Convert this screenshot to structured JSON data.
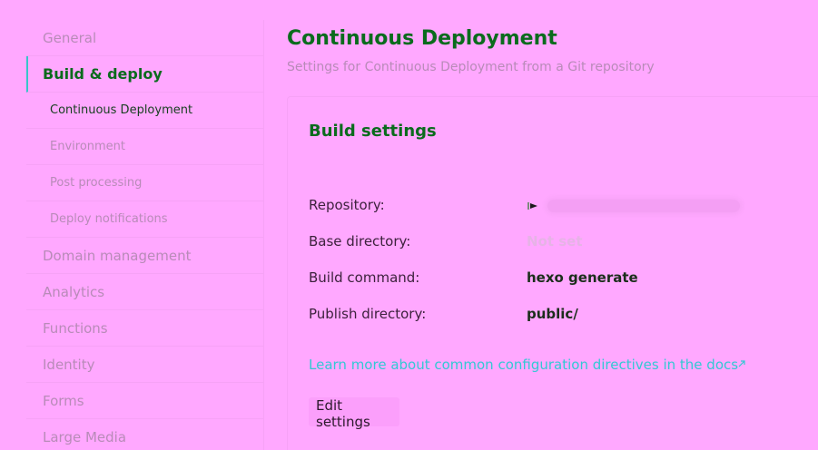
{
  "sidebar": {
    "items": [
      {
        "label": "General"
      },
      {
        "label": "Build & deploy"
      },
      {
        "label": "Continuous Deployment"
      },
      {
        "label": "Environment"
      },
      {
        "label": "Post processing"
      },
      {
        "label": "Deploy notifications"
      },
      {
        "label": "Domain management"
      },
      {
        "label": "Analytics"
      },
      {
        "label": "Functions"
      },
      {
        "label": "Identity"
      },
      {
        "label": "Forms"
      },
      {
        "label": "Large Media"
      }
    ]
  },
  "header": {
    "title": "Continuous Deployment",
    "subtitle": "Settings for Continuous Deployment from a Git repository"
  },
  "build_settings": {
    "title": "Build settings",
    "repository_label": "Repository:",
    "base_directory_label": "Base directory:",
    "base_directory_value": "Not set",
    "build_command_label": "Build command:",
    "build_command_value": "hexo generate",
    "publish_directory_label": "Publish directory:",
    "publish_directory_value": "public/",
    "docs_link": "Learn more about common configuration directives in the docs",
    "edit_button": "Edit settings"
  },
  "icons": {
    "repo": "git-repo-icon",
    "external_link": "external-link-icon"
  },
  "colors": {
    "background": "#ffa8ff",
    "heading": "#0a6b1d",
    "link": "#33c9d3",
    "active_indicator": "#38c4c9"
  }
}
